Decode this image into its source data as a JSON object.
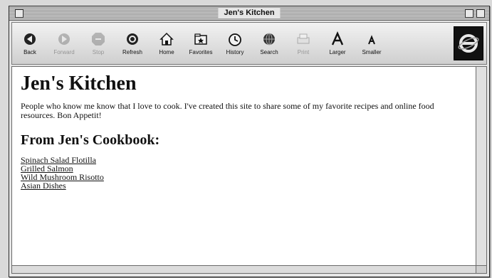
{
  "window": {
    "title": "Jen's Kitchen"
  },
  "toolbar": {
    "buttons": [
      {
        "label": "Back",
        "icon": "back-arrow-icon",
        "enabled": true
      },
      {
        "label": "Forward",
        "icon": "forward-arrow-icon",
        "enabled": false
      },
      {
        "label": "Stop",
        "icon": "stop-icon",
        "enabled": false
      },
      {
        "label": "Refresh",
        "icon": "refresh-icon",
        "enabled": true
      },
      {
        "label": "Home",
        "icon": "home-icon",
        "enabled": true
      },
      {
        "label": "Favorites",
        "icon": "favorites-icon",
        "enabled": true
      },
      {
        "label": "History",
        "icon": "history-icon",
        "enabled": true
      },
      {
        "label": "Search",
        "icon": "search-icon",
        "enabled": true
      },
      {
        "label": "Print",
        "icon": "print-icon",
        "enabled": false
      },
      {
        "label": "Larger",
        "icon": "larger-text-icon",
        "enabled": true
      },
      {
        "label": "Smaller",
        "icon": "smaller-text-icon",
        "enabled": true
      }
    ],
    "logo_icon": "internet-explorer-logo-icon"
  },
  "page": {
    "heading": "Jen's Kitchen",
    "intro": "People who know me know that I love to cook. I've created this site to share some of my favorite recipes and online food resources. Bon Appetit!",
    "subheading": "From Jen's Cookbook:",
    "recipes": [
      "Spinach Salad Flotilla",
      "Grilled Salmon",
      "Wild Mushroom Risotto",
      "Asian Dishes"
    ]
  },
  "colors": {
    "background": "#ffffff",
    "chrome": "#d9d9d9",
    "text": "#111111"
  }
}
